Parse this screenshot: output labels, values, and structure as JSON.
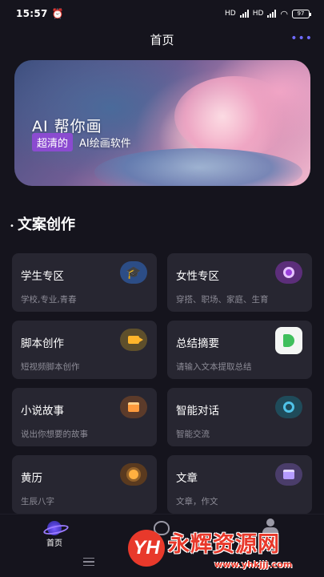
{
  "status_bar": {
    "time": "15:57",
    "network_1": "HD",
    "network_2": "HD",
    "battery": "97"
  },
  "nav": {
    "title": "首页",
    "more_icon": "more-dots-icon",
    "accent_color": "#6f6bff"
  },
  "banner": {
    "title": "AI 帮你画",
    "badge": "超清的",
    "subtitle": "AI绘画软件"
  },
  "section": {
    "title": "文案创作"
  },
  "cards": [
    {
      "title": "学生专区",
      "desc": "学校,专业,青春",
      "icon": "graduation-cap-icon"
    },
    {
      "title": "女性专区",
      "desc": "穿搭、职场、家庭、生育",
      "icon": "female-icon"
    },
    {
      "title": "脚本创作",
      "desc": "短视频脚本创作",
      "icon": "video-camera-icon"
    },
    {
      "title": "总结摘要",
      "desc": "请输入文本提取总结",
      "icon": "summary-icon"
    },
    {
      "title": "小说故事",
      "desc": "说出你想要的故事",
      "icon": "book-icon"
    },
    {
      "title": "智能对话",
      "desc": "智能交流",
      "icon": "chat-icon"
    },
    {
      "title": "黄历",
      "desc": "生辰八字",
      "icon": "sun-icon"
    },
    {
      "title": "文章",
      "desc": "文章，作文",
      "icon": "article-icon"
    }
  ],
  "tab_bar": {
    "home_label": "首页",
    "home_icon": "planet-icon",
    "create_icon": "palette-icon",
    "mine_icon": "user-icon"
  },
  "watermark": {
    "logo": "YH",
    "text": "永辉资源网",
    "url": "www.yhkjjj.com"
  }
}
